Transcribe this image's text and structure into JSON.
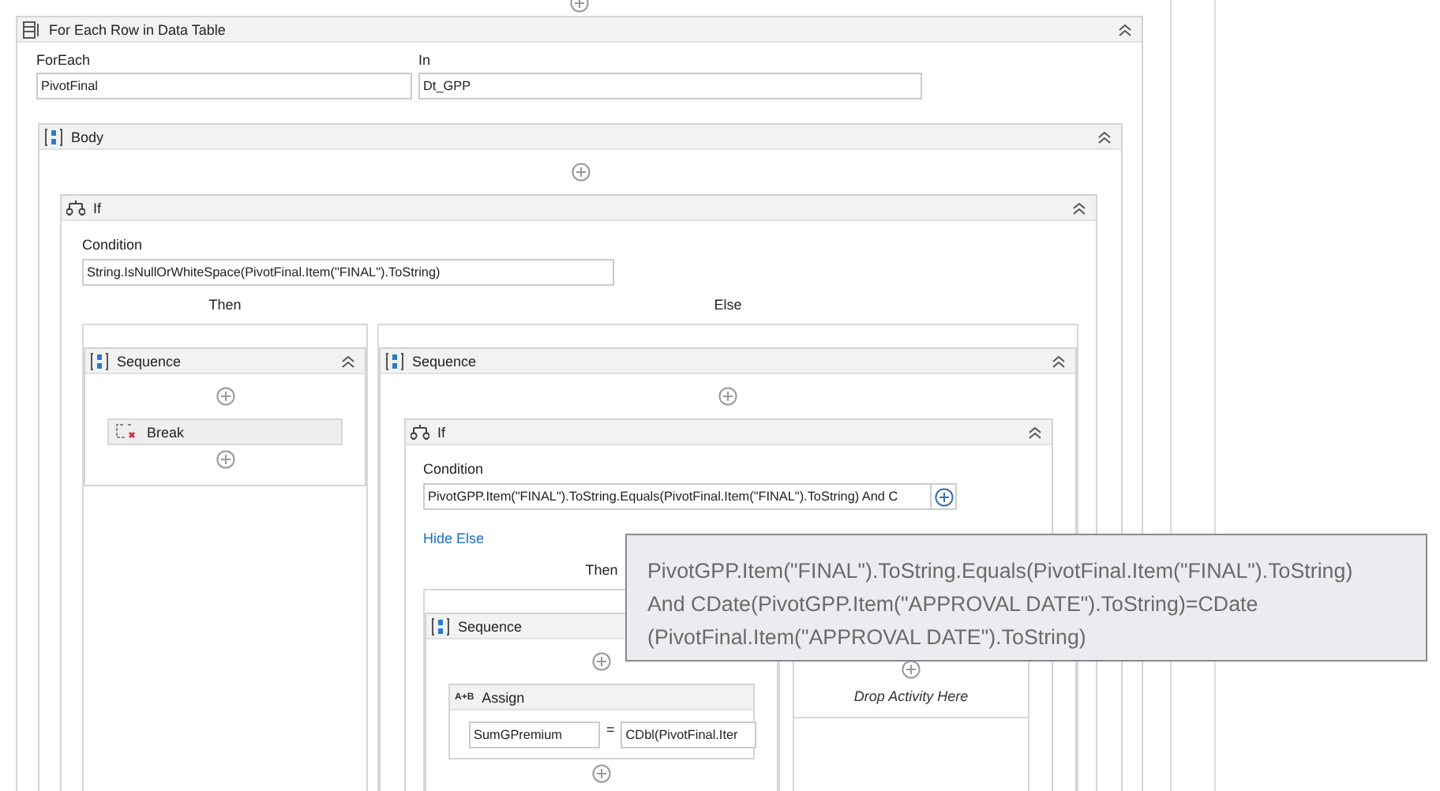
{
  "activity": {
    "kind": "foreach",
    "title": "For Each Row in Data Table",
    "item_label": "ForEach",
    "item_value": "PivotFinal",
    "in_label": "In",
    "in_value": "Dt_GPP",
    "body": {
      "kind": "sequence",
      "title": "Body",
      "children": [
        {
          "kind": "if",
          "title": "If",
          "condition_label": "Condition",
          "condition": "String.IsNullOrWhiteSpace(PivotFinal.Item(\"FINAL\").ToString)",
          "then_label": "Then",
          "else_label": "Else",
          "then": [
            {
              "kind": "sequence",
              "title": "Sequence",
              "children": [
                {
                  "kind": "break",
                  "title": "Break"
                }
              ]
            }
          ],
          "else": [
            {
              "kind": "sequence",
              "title": "Sequence",
              "children": [
                {
                  "kind": "if",
                  "title": "If",
                  "condition_label": "Condition",
                  "condition": "PivotGPP.Item(\"FINAL\").ToString.Equals(PivotFinal.Item(\"FINAL\").ToString) And C",
                  "hide_else": "Hide Else",
                  "then_label": "Then",
                  "then": [
                    {
                      "kind": "sequence",
                      "title": "Sequence",
                      "children": [
                        {
                          "kind": "assign",
                          "title": "Assign",
                          "icon_label": "A+B",
                          "to": "SumGPremium",
                          "op": "=",
                          "value": "CDbl(PivotFinal.Iter"
                        }
                      ]
                    }
                  ],
                  "else": [
                    {
                      "kind": "drop",
                      "text": "Drop Activity Here"
                    }
                  ]
                }
              ]
            }
          ]
        }
      ]
    }
  },
  "tooltip": {
    "text": "PivotGPP.Item(\"FINAL\").ToString.Equals(PivotFinal.Item(\"FINAL\").ToString) And CDate(PivotGPP.Item(\"APPROVAL DATE\").ToString)=CDate (PivotFinal.Item(\"APPROVAL DATE\").ToString)"
  }
}
